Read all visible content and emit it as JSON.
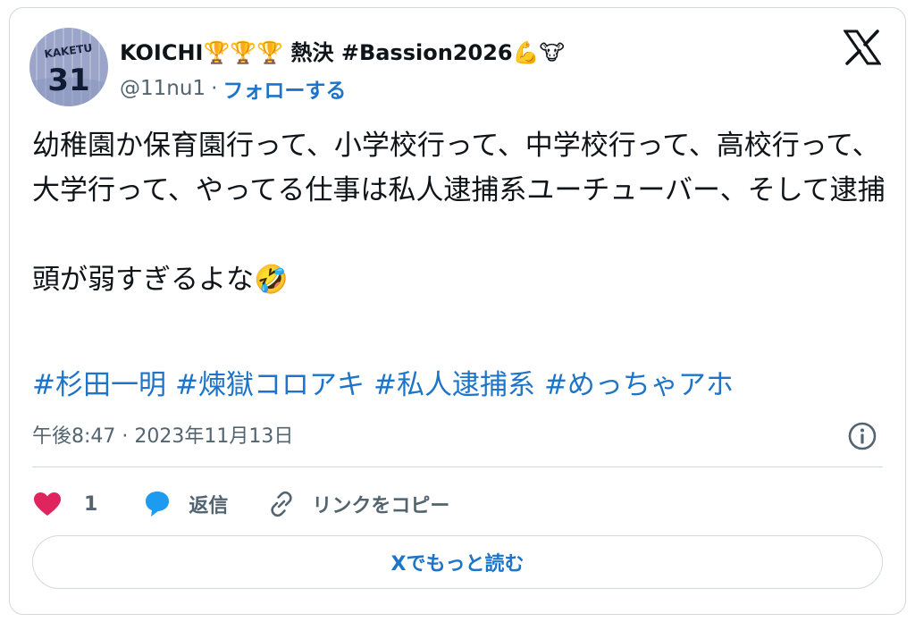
{
  "user": {
    "display_name": "KOICHI🏆🏆🏆 熱決 #Bassion2026💪🐮",
    "handle": "@11nu1",
    "separator": "·",
    "follow_label": "フォローする",
    "avatar_jersey_text": "KAKETU",
    "avatar_jersey_number": "31"
  },
  "header": {
    "logo": "x-logo-icon"
  },
  "tweet": {
    "paragraphs": [
      "幼稚園か保育園行って、小学校行って、中学校行って、高校行って、大学行って、やってる仕事は私人逮捕系ユーチューバー、そして逮捕",
      "頭が弱すぎるよな🤣"
    ],
    "hashtags": [
      "#杉田一明",
      "#煉獄コロアキ",
      "#私人逮捕系",
      "#めっちゃアホ"
    ],
    "timestamp": "午後8:47 · 2023年11月13日"
  },
  "actions": {
    "like_count": "1",
    "reply_label": "返信",
    "copy_link_label": "リンクをコピー"
  },
  "read_more_label": "Xでもっと読む",
  "colors": {
    "link": "#1d74c8",
    "like": "#e0245e",
    "reply_icon": "#1d9bf0",
    "secondary_text": "#536471",
    "border": "#cfd9de"
  }
}
